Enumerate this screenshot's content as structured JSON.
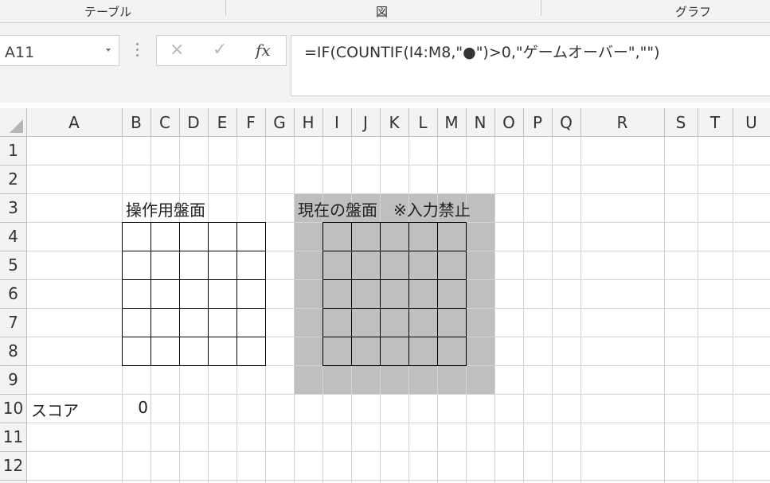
{
  "ribbon": {
    "groups": [
      "テーブル",
      "図",
      "グラフ"
    ]
  },
  "formula_bar": {
    "name_box": "A11",
    "cancel_icon": "×",
    "enter_icon": "✓",
    "fx_label": "fx",
    "formula": "=IF(COUNTIF(I4:M8,\"●\")>0,\"ゲームオーバー\",\"\")"
  },
  "sheet": {
    "columns": [
      "A",
      "B",
      "C",
      "D",
      "E",
      "F",
      "G",
      "H",
      "I",
      "J",
      "K",
      "L",
      "M",
      "N",
      "O",
      "P",
      "Q",
      "R",
      "S",
      "T",
      "U"
    ],
    "rows": [
      "1",
      "2",
      "3",
      "4",
      "5",
      "6",
      "7",
      "8",
      "9",
      "10",
      "11",
      "12"
    ],
    "cells": {
      "B3": "操作用盤面",
      "H3": "現在の盤面　※入力禁止",
      "A10": "スコア",
      "B10": "0"
    }
  },
  "colors": {
    "shaded_board": "#bfbfbf",
    "selected_header": "#e8e8e8",
    "gridline": "#d4d4d4"
  }
}
